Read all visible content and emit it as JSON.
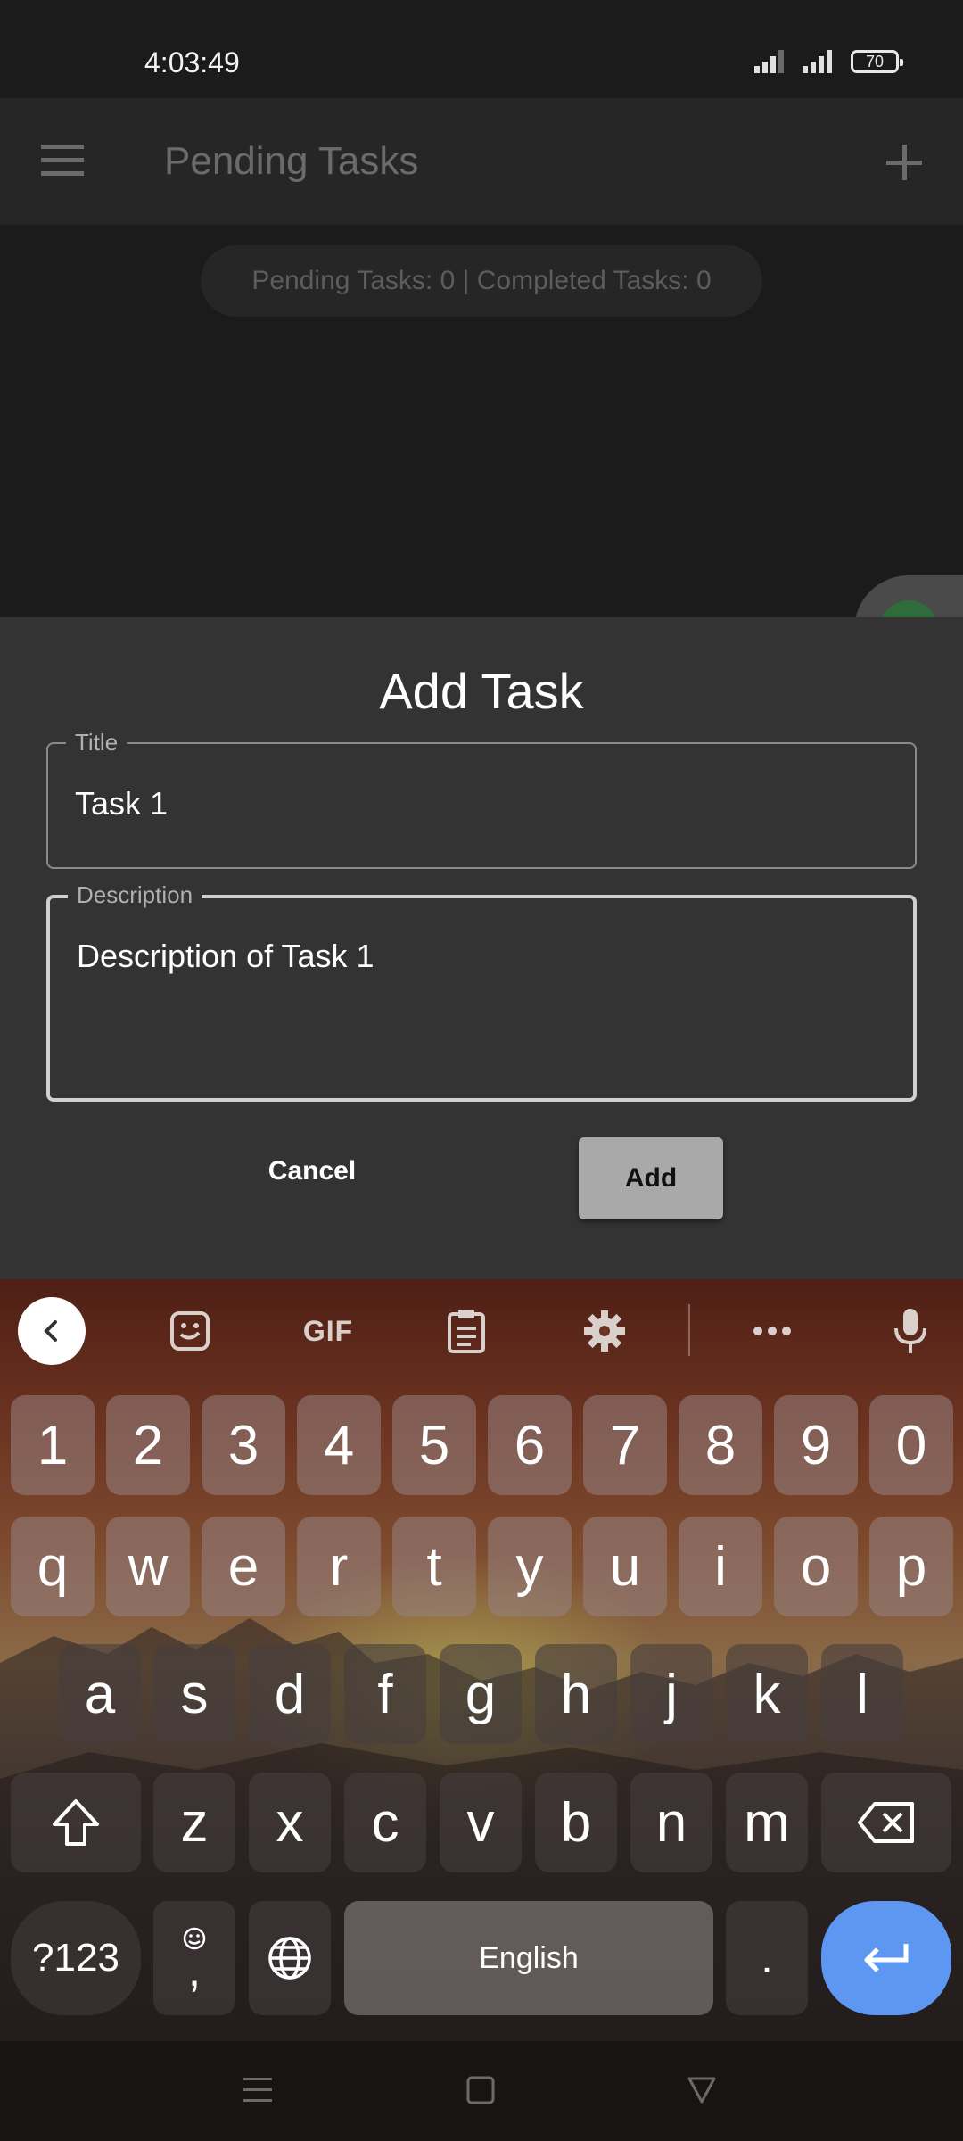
{
  "status_bar": {
    "time": "4:03:49",
    "battery": "70"
  },
  "app_bar": {
    "title": "Pending Tasks"
  },
  "counter": {
    "text": "Pending Tasks:  0 | Completed Tasks:  0"
  },
  "floating_bubble": {
    "label": "···"
  },
  "dialog": {
    "title": "Add Task",
    "title_field": {
      "label": "Title",
      "value": "Task 1"
    },
    "description_field": {
      "label": "Description",
      "value": "Description of Task 1"
    },
    "cancel_label": "Cancel",
    "add_label": "Add"
  },
  "keyboard": {
    "toolbar": {
      "gif_label": "GIF"
    },
    "row_numbers": [
      "1",
      "2",
      "3",
      "4",
      "5",
      "6",
      "7",
      "8",
      "9",
      "0"
    ],
    "row_top": [
      "q",
      "w",
      "e",
      "r",
      "t",
      "y",
      "u",
      "i",
      "o",
      "p"
    ],
    "row_middle": [
      "a",
      "s",
      "d",
      "f",
      "g",
      "h",
      "j",
      "k",
      "l"
    ],
    "row_bottom": [
      "z",
      "x",
      "c",
      "v",
      "b",
      "n",
      "m"
    ],
    "symbols_label": "?123",
    "comma_label": ",",
    "space_label": "English",
    "period_label": ".",
    "accent_color": "#5d97f2"
  },
  "icons": [
    "menu-icon",
    "add-icon",
    "chevron-left-icon",
    "sticker-icon",
    "clipboard-icon",
    "gear-icon",
    "more-icon",
    "microphone-icon",
    "shift-icon",
    "backspace-icon",
    "emoji-icon",
    "globe-icon",
    "enter-icon",
    "nav-recents-icon",
    "nav-home-icon",
    "nav-back-icon",
    "signal-icon",
    "battery-icon"
  ]
}
